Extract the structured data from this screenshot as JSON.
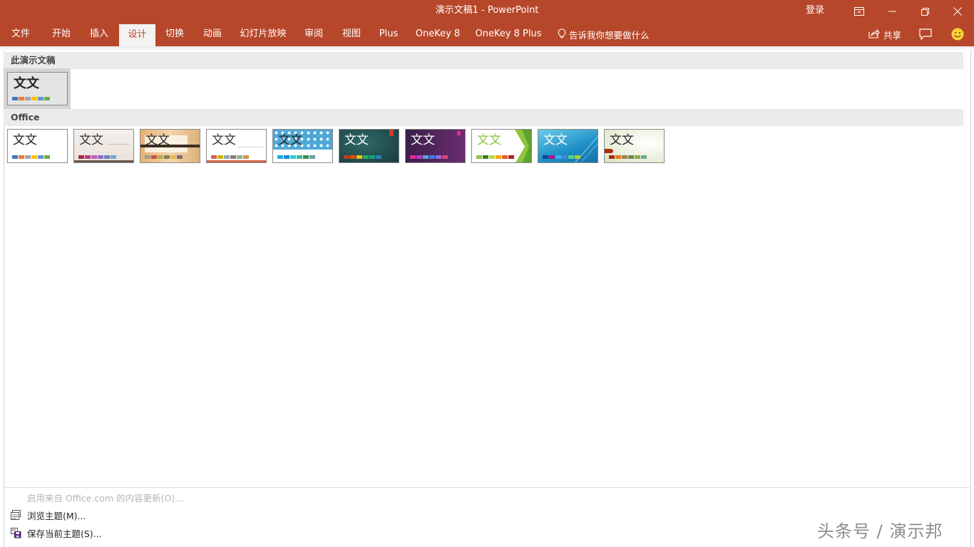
{
  "window": {
    "title": "演示文稿1  -  PowerPoint",
    "signin": "登录",
    "colors": {
      "accent": "#b7472a",
      "tab_bg": "#f3f3f3"
    }
  },
  "ribbon": {
    "tabs": [
      {
        "id": "file",
        "label": "文件"
      },
      {
        "id": "home",
        "label": "开始"
      },
      {
        "id": "insert",
        "label": "插入"
      },
      {
        "id": "design",
        "label": "设计",
        "active": true
      },
      {
        "id": "transitions",
        "label": "切换"
      },
      {
        "id": "animations",
        "label": "动画"
      },
      {
        "id": "slideshow",
        "label": "幻灯片放映"
      },
      {
        "id": "review",
        "label": "审阅"
      },
      {
        "id": "view",
        "label": "视图"
      },
      {
        "id": "plus",
        "label": "Plus"
      },
      {
        "id": "onekey8",
        "label": "OneKey 8"
      },
      {
        "id": "onekey8plus",
        "label": "OneKey 8 Plus"
      }
    ],
    "tell_me": "告诉我你想要做什么",
    "share": "共享"
  },
  "gallery": {
    "this_presentation": {
      "header": "此演示文稿",
      "theme": {
        "sample": "文文",
        "swatches": [
          "#4472c4",
          "#ed7d31",
          "#a5a5a5",
          "#ffc000",
          "#5b9bd5",
          "#70ad47"
        ]
      }
    },
    "office": {
      "header": "Office",
      "themes": [
        {
          "sample": "文文",
          "text_color": "#222222",
          "swatches": [
            "#4472c4",
            "#ed7d31",
            "#a5a5a5",
            "#ffc000",
            "#5b9bd5",
            "#70ad47"
          ]
        },
        {
          "sample": "文文",
          "text_color": "#333333",
          "swatches": [
            "#a5294a",
            "#c0387d",
            "#b660c6",
            "#8e6cc4",
            "#6c82c0",
            "#72a6c4"
          ]
        },
        {
          "sample": "文文",
          "text_color": "#222222",
          "swatches": [
            "#93a299",
            "#cf543f",
            "#b5ae53",
            "#848058",
            "#e8b54d",
            "#786c71"
          ]
        },
        {
          "sample": "文文",
          "text_color": "#333333",
          "swatches": [
            "#d16349",
            "#ccb400",
            "#8cadae",
            "#8c7b70",
            "#8fb08c",
            "#d19049"
          ]
        },
        {
          "sample": "文文",
          "text_color": "#222222",
          "swatches": [
            "#1cade4",
            "#2683c6",
            "#27ced7",
            "#42ba97",
            "#3e8853",
            "#62a39f"
          ]
        },
        {
          "sample": "文文",
          "text_color": "#ffffff",
          "swatches": [
            "#c0392b",
            "#d35400",
            "#f1c40f",
            "#27ae60",
            "#16a085",
            "#2980b9"
          ]
        },
        {
          "sample": "文文",
          "text_color": "#ffffff",
          "swatches": [
            "#e32d91",
            "#c830cc",
            "#4ea6dc",
            "#4775e7",
            "#8971e1",
            "#d54773"
          ]
        },
        {
          "sample": "文文",
          "text_color": "#8cc63f",
          "swatches": [
            "#8cc63f",
            "#3a7d22",
            "#c0d834",
            "#f2a61f",
            "#e55a2b",
            "#b3211f"
          ]
        },
        {
          "sample": "文文",
          "text_color": "#ffffff",
          "swatches": [
            "#1c3f94",
            "#b0127a",
            "#31b6fd",
            "#4584d3",
            "#5bd078",
            "#a5d028"
          ]
        },
        {
          "sample": "文文",
          "text_color": "#222222",
          "swatches": [
            "#a53010",
            "#de7e18",
            "#9f8351",
            "#728653",
            "#92aa4c",
            "#6aac91"
          ]
        }
      ]
    }
  },
  "menu": {
    "enable_updates": "启用来自 Office.com 的内容更新(O)...",
    "browse": "浏览主题(M)...",
    "save": "保存当前主题(S)..."
  },
  "watermark": "头条号 / 演示邦"
}
